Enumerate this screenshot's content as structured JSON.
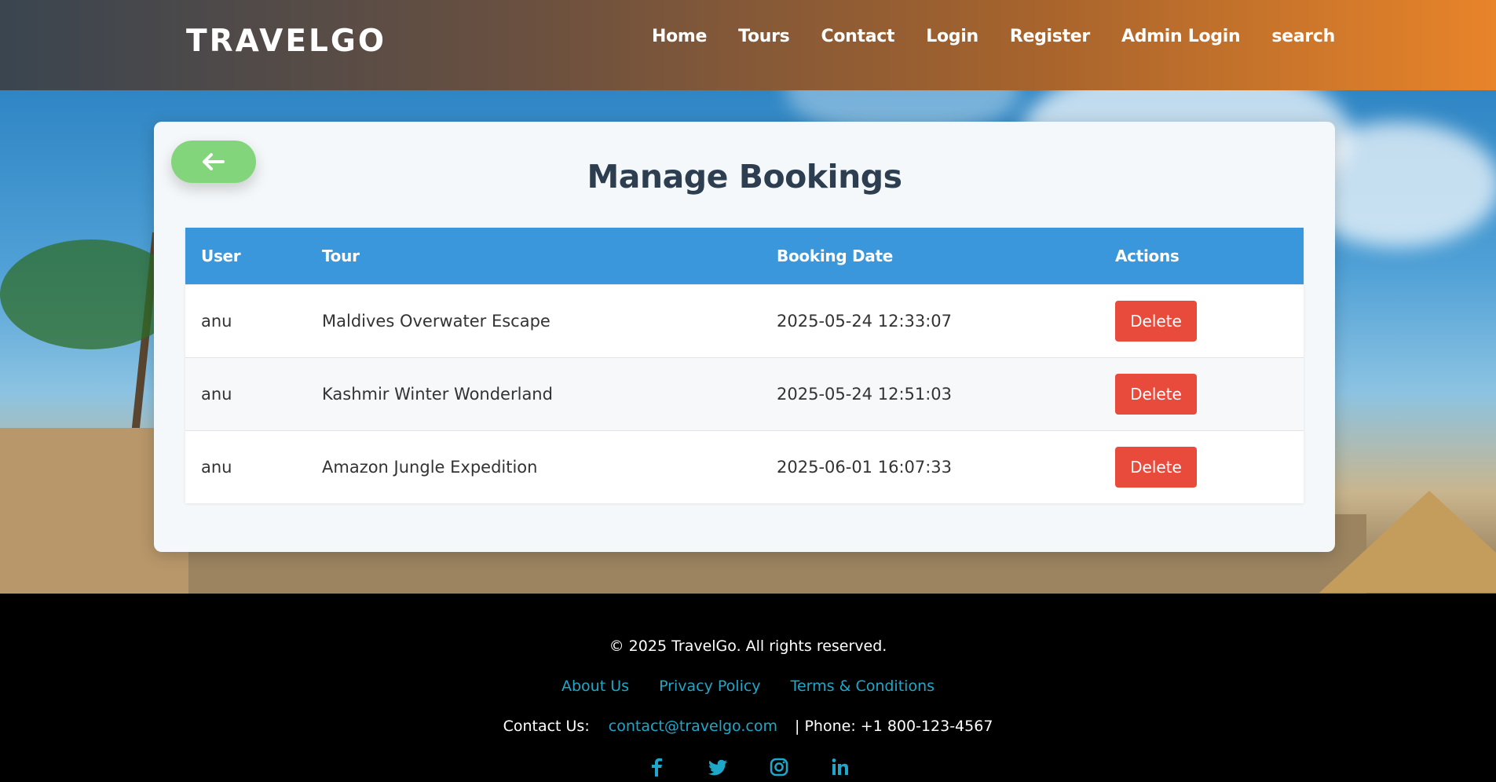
{
  "header": {
    "logo": "TRAVELGO",
    "nav": [
      "Home",
      "Tours",
      "Contact",
      "Login",
      "Register",
      "Admin Login",
      "search"
    ]
  },
  "main": {
    "title": "Manage Bookings",
    "columns": [
      "User",
      "Tour",
      "Booking Date",
      "Actions"
    ],
    "rows": [
      {
        "user": "anu",
        "tour": "Maldives Overwater Escape",
        "date": "2025-05-24 12:33:07",
        "action": "Delete"
      },
      {
        "user": "anu",
        "tour": "Kashmir Winter Wonderland",
        "date": "2025-05-24 12:51:03",
        "action": "Delete"
      },
      {
        "user": "anu",
        "tour": "Amazon Jungle Expedition",
        "date": "2025-06-01 16:07:33",
        "action": "Delete"
      }
    ]
  },
  "footer": {
    "copyright": "© 2025 TravelGo. All rights reserved.",
    "links": [
      "About Us",
      "Privacy Policy",
      "Terms & Conditions"
    ],
    "contact_label": "Contact Us:",
    "email": "contact@travelgo.com",
    "phone": "| Phone: +1 800-123-4567",
    "social_icons": [
      "facebook-icon",
      "twitter-icon",
      "instagram-icon",
      "linkedin-icon"
    ]
  },
  "colors": {
    "table_header": "#3a97db",
    "delete_button": "#e84a3c",
    "back_button": "#82d57a",
    "footer_link": "#1ea7c8"
  }
}
